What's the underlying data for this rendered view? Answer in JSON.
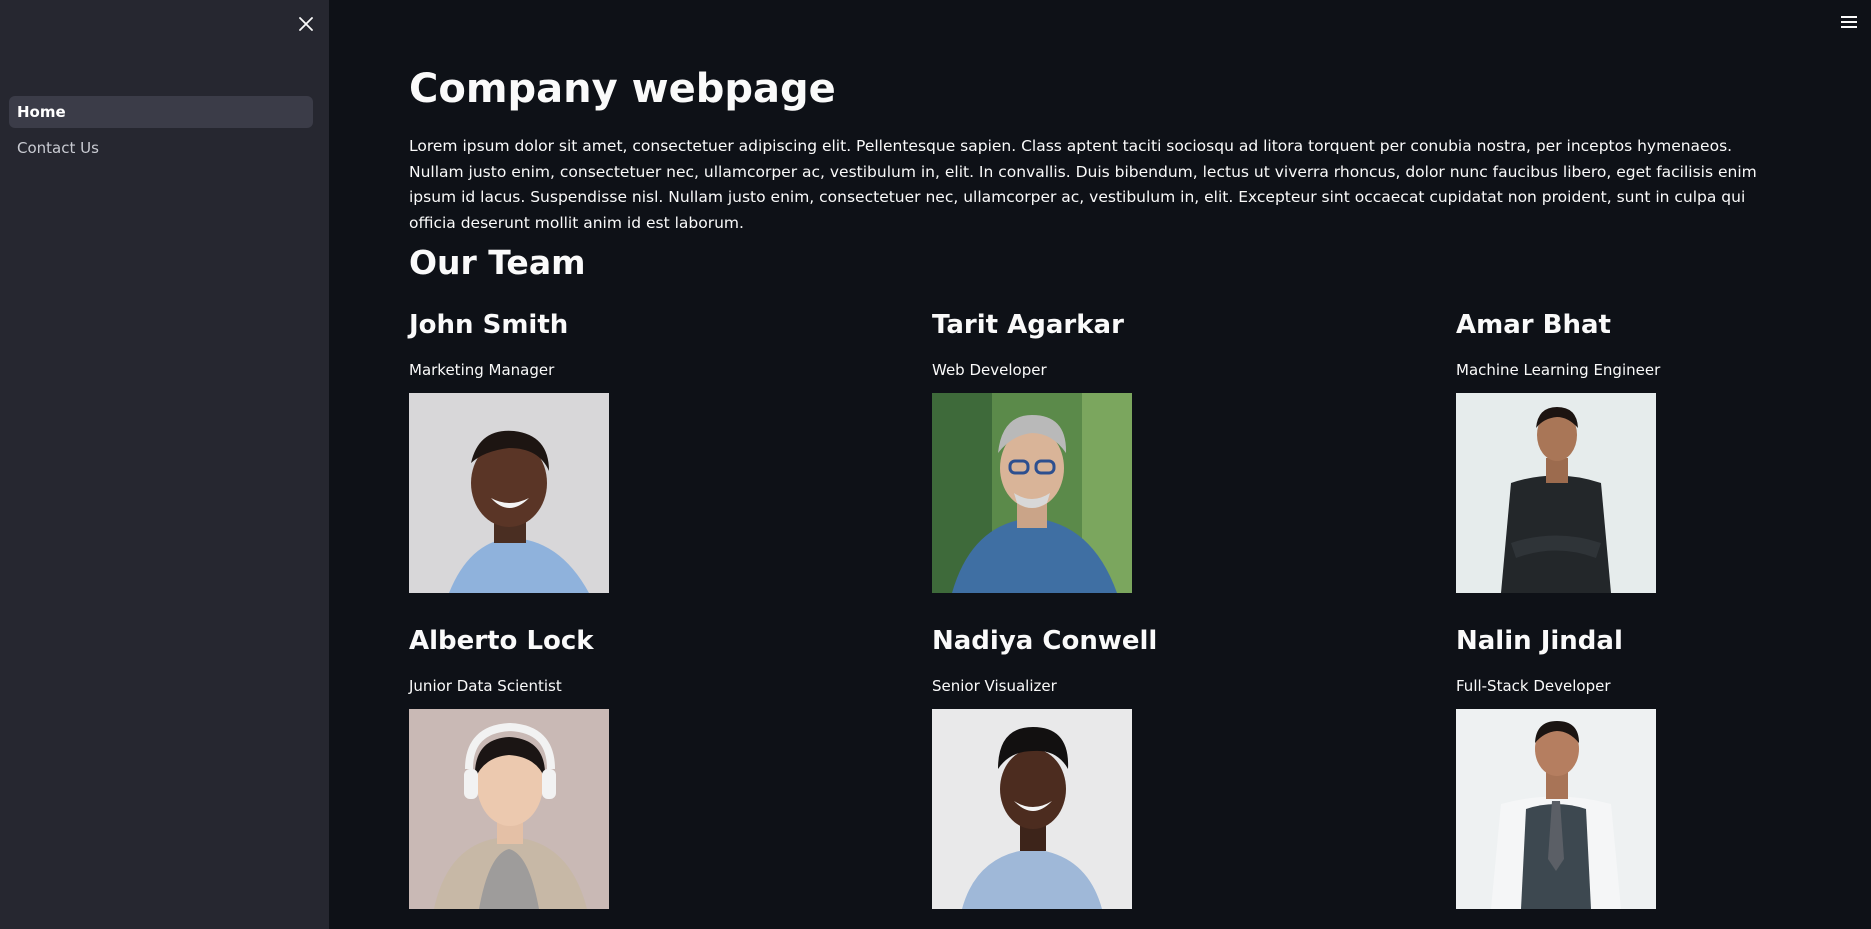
{
  "sidebar": {
    "close_icon": "close-icon",
    "items": [
      {
        "label": "Home",
        "active": true
      },
      {
        "label": "Contact Us",
        "active": false
      }
    ]
  },
  "main_menu_icon": "hamburger-menu-icon",
  "page": {
    "title": "Company webpage",
    "intro": "Lorem ipsum dolor sit amet, consectetuer adipiscing elit. Pellentesque sapien. Class aptent taciti sociosqu ad litora torquent per conubia nostra, per inceptos hymenaeos. Nullam justo enim, consectetuer nec, ullamcorper ac, vestibulum in, elit. In convallis. Duis bibendum, lectus ut viverra rhoncus, dolor nunc faucibus libero, eget facilisis enim ipsum id lacus. Suspendisse nisl. Nullam justo enim, consectetuer nec, ullamcorper ac, vestibulum in, elit. Excepteur sint occaecat cupidatat non proident, sunt in culpa qui officia deserunt mollit anim id est laborum.",
    "team_title": "Our Team"
  },
  "team": [
    {
      "name": "John Smith",
      "role": "Marketing Manager"
    },
    {
      "name": "Tarit Agarkar",
      "role": "Web Developer"
    },
    {
      "name": "Amar Bhat",
      "role": "Machine Learning Engineer"
    },
    {
      "name": "Alberto Lock",
      "role": "Junior Data Scientist"
    },
    {
      "name": "Nadiya Conwell",
      "role": "Senior Visualizer"
    },
    {
      "name": "Nalin Jindal",
      "role": "Full-Stack Developer"
    }
  ],
  "colors": {
    "background": "#0e1117",
    "sidebar": "#262730",
    "text": "#fafafa"
  }
}
